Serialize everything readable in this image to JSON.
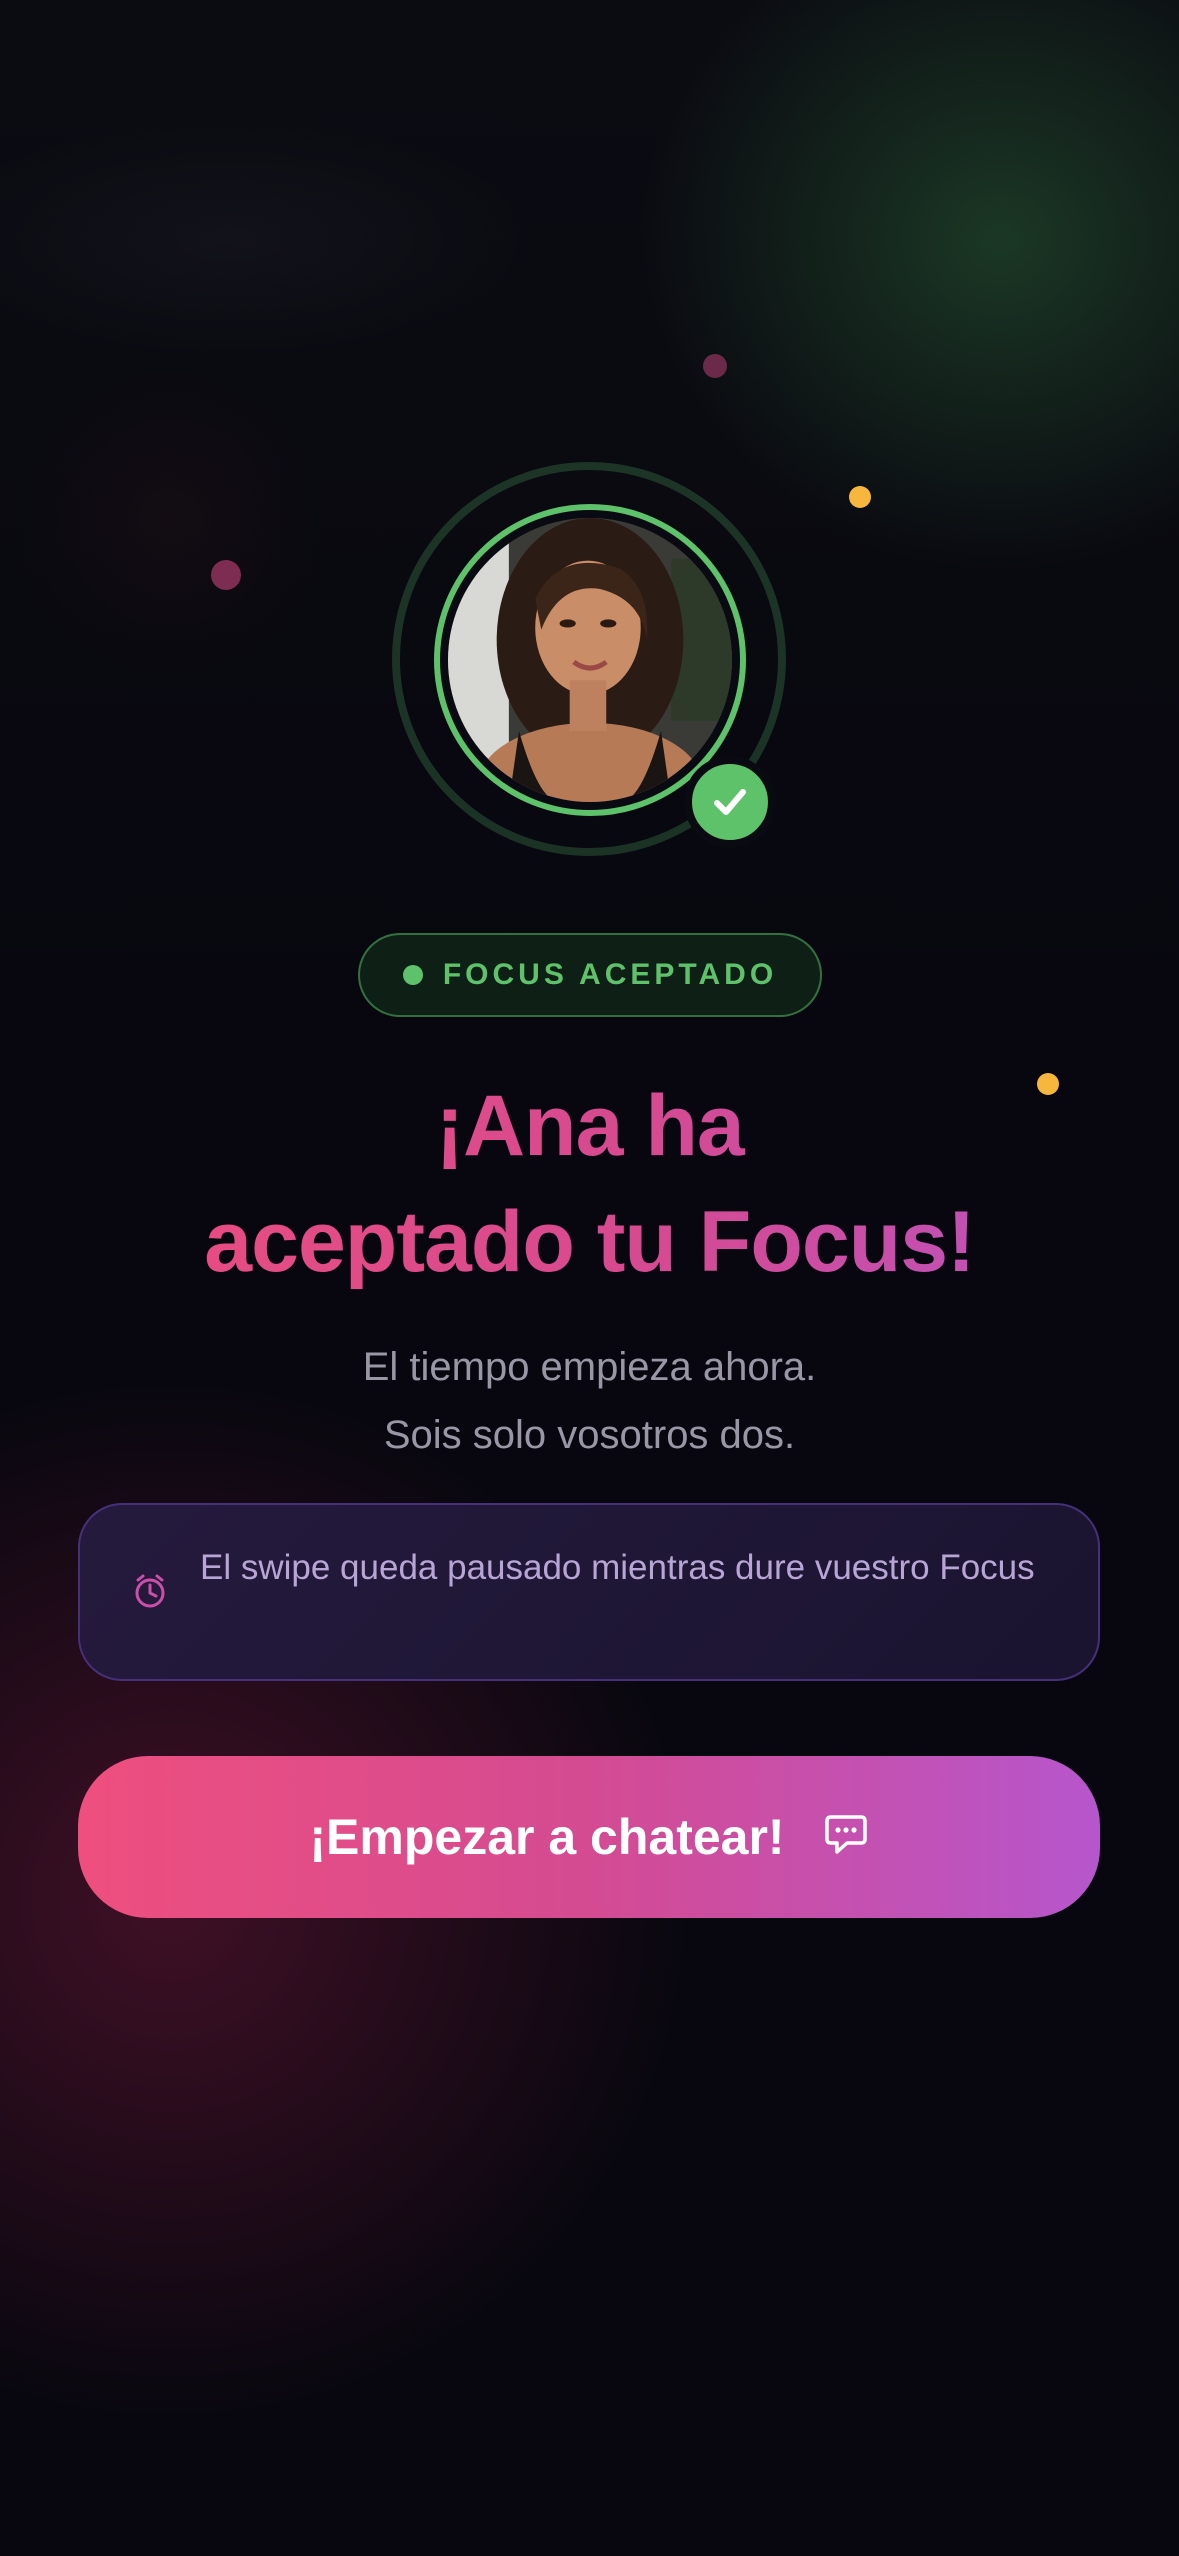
{
  "status_pill": {
    "label": "FOCUS ACEPTADO"
  },
  "headline": {
    "line1": "¡Ana ha",
    "line2": "aceptado tu Focus!"
  },
  "subtitle": {
    "line1": "El tiempo empieza ahora.",
    "line2": "Sois solo vosotros dos."
  },
  "info_card": {
    "icon": "timer-icon",
    "text": "El swipe queda pausado mientras dure vuestro Focus"
  },
  "cta_button": {
    "label": "¡Empezar a chatear!",
    "icon": "chat-bubble-icon"
  },
  "profile": {
    "verified_icon": "check-icon"
  },
  "colors": {
    "accent_green": "#5ec26a",
    "accent_pink": "#ee4d7c",
    "accent_purple": "#b654c8",
    "confetti_yellow": "#f7b73c",
    "background": "#08070f"
  }
}
